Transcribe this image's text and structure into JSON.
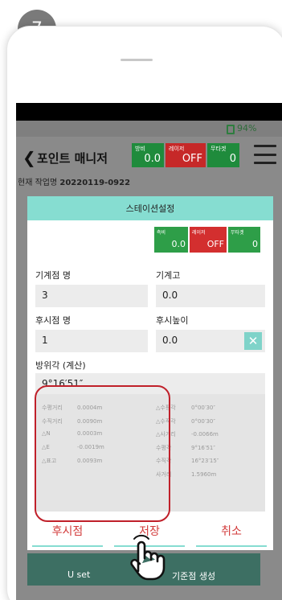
{
  "step_number": "7",
  "status": {
    "battery": "94%"
  },
  "header": {
    "title": "포인트 매니저",
    "indicators": [
      {
        "label": "방비",
        "value": "0.0",
        "color": "#1f8b3c"
      },
      {
        "label": "레이저",
        "value": "OFF",
        "color": "#c62828"
      },
      {
        "label": "무타겟",
        "value": "0",
        "color": "#1f8b3c"
      }
    ]
  },
  "job": {
    "label": "현재 작업명",
    "name": "20220119-0922"
  },
  "bottom_bar": {
    "left": "U set",
    "right": "기준점 생성"
  },
  "dialog": {
    "title": "스테이션설정",
    "chips": [
      {
        "label": "측비",
        "value": "0.0",
        "color": "#2e9e48"
      },
      {
        "label": "레이저",
        "value": "OFF",
        "color": "#d32f2f"
      },
      {
        "label": "무타겟",
        "value": "0",
        "color": "#2e9e48"
      }
    ],
    "instrument_point_label": "기계점 명",
    "instrument_point_value": "3",
    "instrument_height_label": "기계고",
    "instrument_height_value": "0.0",
    "backsight_label": "후시점 명",
    "backsight_value": "1",
    "backsight_height_label": "후시높이",
    "backsight_height_value": "0.0",
    "azimuth_label": "방위각 (계산)",
    "azimuth_value": "9°16′51″",
    "info_left": [
      {
        "k": "수평거리",
        "v": "0.0004m"
      },
      {
        "k": "수직거리",
        "v": "0.0090m"
      },
      {
        "k": "△N",
        "v": "0.0003m"
      },
      {
        "k": "△E",
        "v": "-0.0019m"
      },
      {
        "k": "△표고",
        "v": "0.0093m"
      }
    ],
    "info_right": [
      {
        "k": "△수평각",
        "v": "0°00′30″"
      },
      {
        "k": "△수직각",
        "v": "0°00′30″"
      },
      {
        "k": "△사거리",
        "v": "-0.0066m"
      },
      {
        "k": "수평각",
        "v": "9°16′51″"
      },
      {
        "k": "수직각",
        "v": "16°23′15″"
      },
      {
        "k": "사거리",
        "v": "1.5960m"
      }
    ],
    "buttons": {
      "backsight": "후시점",
      "save": "저장",
      "cancel": "취소"
    }
  }
}
